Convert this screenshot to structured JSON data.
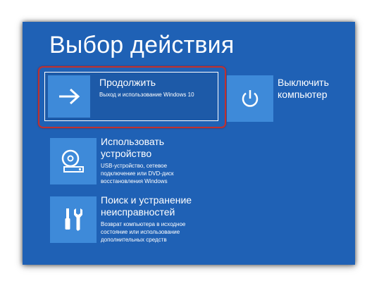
{
  "page": {
    "title": "Выбор действия"
  },
  "options": {
    "continue": {
      "title": "Продолжить",
      "description": "Выход и использование Windows 10",
      "icon": "arrow-right-icon",
      "selected": true
    },
    "power_off": {
      "title_line1": "Выключить",
      "title_line2": "компьютер",
      "icon": "power-icon"
    },
    "use_device": {
      "title_line1": "Использовать",
      "title_line2": "устройство",
      "desc_line1": "USB-устройство, сетевое",
      "desc_line2": "подключение или DVD-диск",
      "desc_line3": "восстановления Windows",
      "icon": "disc-drive-icon"
    },
    "troubleshoot": {
      "title_line1": "Поиск и устранение",
      "title_line2": "неисправностей",
      "desc_line1": "Возврат компьютера в исходное",
      "desc_line2": "состояние или использование",
      "desc_line3": "дополнительных средств",
      "icon": "tools-icon"
    }
  },
  "colors": {
    "background": "#1f61b5",
    "tile": "#3e8ad9",
    "highlight": "#c0302f",
    "text": "#ffffff"
  }
}
